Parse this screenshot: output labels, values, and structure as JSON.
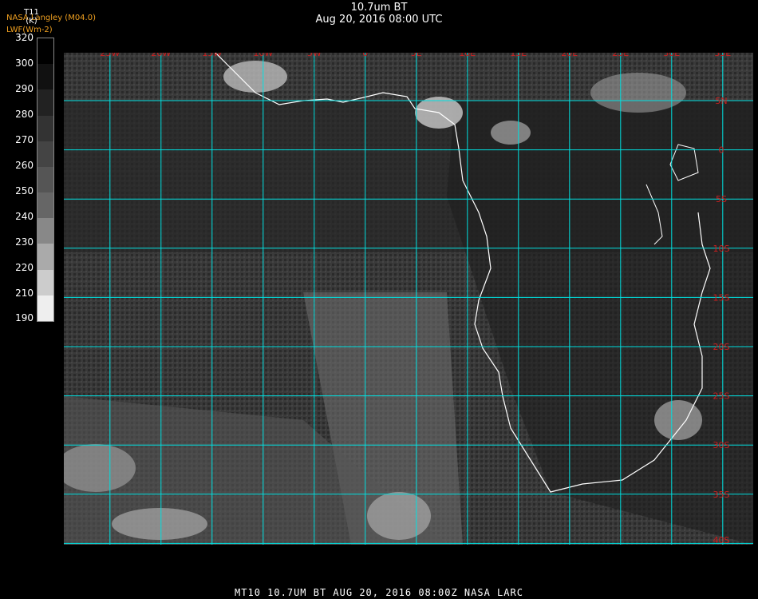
{
  "header": {
    "title": "10.7um BT",
    "subtitle": "Aug 20, 2016 08:00 UTC",
    "credit": "NASA Langley (M04.0)",
    "credit2": "LWF(Wm-2)"
  },
  "colorbar": {
    "label": "T11",
    "unit": "(K)",
    "ticks": [
      "320",
      "300",
      "290",
      "280",
      "270",
      "260",
      "250",
      "240",
      "230",
      "220",
      "210",
      "190"
    ]
  },
  "map": {
    "lon_labels": [
      "25W",
      "20W",
      "15W",
      "10W",
      "5W",
      "0",
      "5E",
      "10E",
      "15E",
      "20E",
      "25E",
      "30E",
      "35E"
    ],
    "lat_labels": [
      "5N",
      "0",
      "5S",
      "10S",
      "15S",
      "20S",
      "25S",
      "30S",
      "35S",
      "40S"
    ],
    "grid_color": "#00e0e0",
    "label_color": "#cc2020",
    "coast_color": "#ffffff"
  },
  "footer": {
    "text": "MT10  10.7UM BT   AUG 20, 2016 08:00Z  NASA LARC"
  }
}
